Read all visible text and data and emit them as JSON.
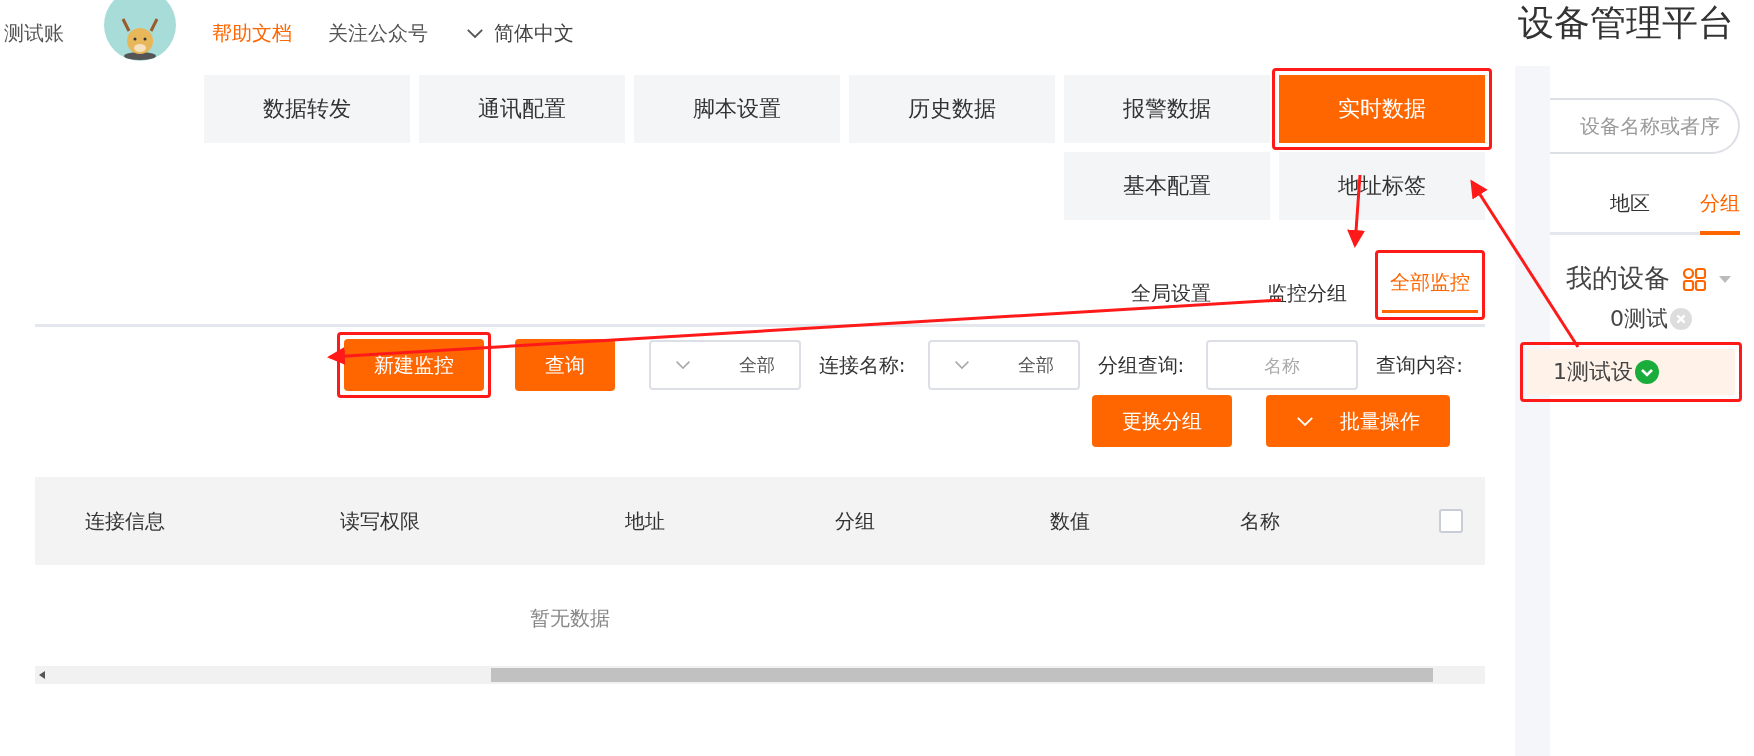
{
  "header": {
    "title": "设备管理平台",
    "language": "简体中文",
    "links": [
      {
        "label": "帮助文档",
        "highlighted": true
      },
      {
        "label": "关注公众号",
        "highlighted": false
      }
    ],
    "account": "测试账"
  },
  "nav": {
    "rows": [
      [
        {
          "label": "数据转发",
          "selected": false,
          "annotated": false
        },
        {
          "label": "通讯配置",
          "selected": false,
          "annotated": false
        },
        {
          "label": "脚本设置",
          "selected": false,
          "annotated": false
        },
        {
          "label": "历史数据",
          "selected": false,
          "annotated": false
        },
        {
          "label": "报警数据",
          "selected": false,
          "annotated": false
        },
        {
          "label": "实时数据",
          "selected": true,
          "annotated": true
        }
      ],
      [
        "",
        "",
        "",
        "",
        {
          "label": "基本配置",
          "selected": false,
          "annotated": false
        },
        {
          "label": "地址标签",
          "selected": false,
          "annotated": false
        }
      ]
    ]
  },
  "subtabs": [
    {
      "label": "全局设置",
      "selected": false,
      "annotated": false
    },
    {
      "label": "监控分组",
      "selected": false,
      "annotated": false
    },
    {
      "label": "全部监控",
      "selected": true,
      "annotated": true
    }
  ],
  "buttons": [
    {
      "label": "新建监控",
      "annotated": true
    },
    {
      "label": "查询",
      "annotated": false
    }
  ],
  "filters": [
    {
      "kind": "select",
      "label": "连接名称:",
      "value": "全部"
    },
    {
      "kind": "select",
      "label": "分组查询:",
      "value": "全部"
    },
    {
      "kind": "text",
      "label": "查询内容:",
      "placeholder": "名称"
    }
  ],
  "actions": [
    {
      "label": "更换分组",
      "dropdown": false
    },
    {
      "label": "批量操作",
      "dropdown": true
    }
  ],
  "table": {
    "columns": [
      "连接信息",
      "读写权限",
      "地址",
      "分组",
      "数值",
      "名称"
    ],
    "select_all": {
      "checked": false
    },
    "empty_text": "暂无数据"
  },
  "sidebar": {
    "search_placeholder": "设备名称或者序",
    "tabs": [
      {
        "label": "地区",
        "selected": false
      },
      {
        "label": "分组",
        "selected": true
      }
    ],
    "tree": {
      "label": "我的设备",
      "expanded": true,
      "children": [
        {
          "label": "0测试",
          "online": false,
          "selected": false,
          "annotated": false
        },
        {
          "label": "1测试设",
          "online": true,
          "selected": true,
          "annotated": true
        }
      ]
    }
  }
}
